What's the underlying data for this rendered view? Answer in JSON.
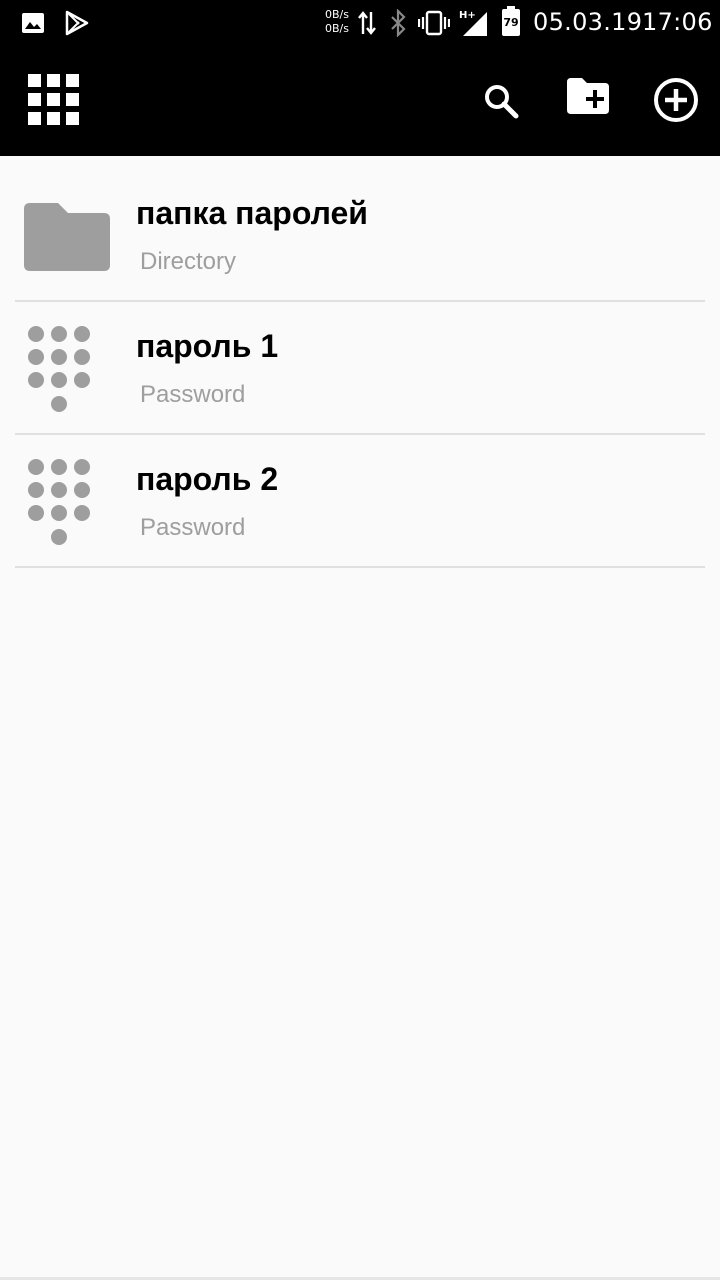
{
  "status_bar": {
    "net_up": "0B/s",
    "net_down": "0B/s",
    "battery_level": "79",
    "date": "05.03.19",
    "time": "17:06",
    "icons": [
      "image-icon",
      "play-store-icon",
      "data-transfer-icon",
      "bluetooth-icon",
      "vibrate-icon",
      "signal-hplus-icon",
      "battery-icon"
    ]
  },
  "toolbar": {
    "menu_icon": "apps-grid-icon",
    "actions": [
      "search-icon",
      "new-folder-icon",
      "add-circle-icon"
    ]
  },
  "items": [
    {
      "title": "папка паролей",
      "type": "Directory",
      "icon": "folder-icon"
    },
    {
      "title": "пароль 1",
      "type": "Password",
      "icon": "keypad-icon"
    },
    {
      "title": "пароль 2",
      "type": "Password",
      "icon": "keypad-icon"
    }
  ],
  "colors": {
    "bar_background": "#000000",
    "list_background": "#fafafa",
    "icon_gray": "#9e9e9e",
    "divider": "#e0e0e0"
  }
}
